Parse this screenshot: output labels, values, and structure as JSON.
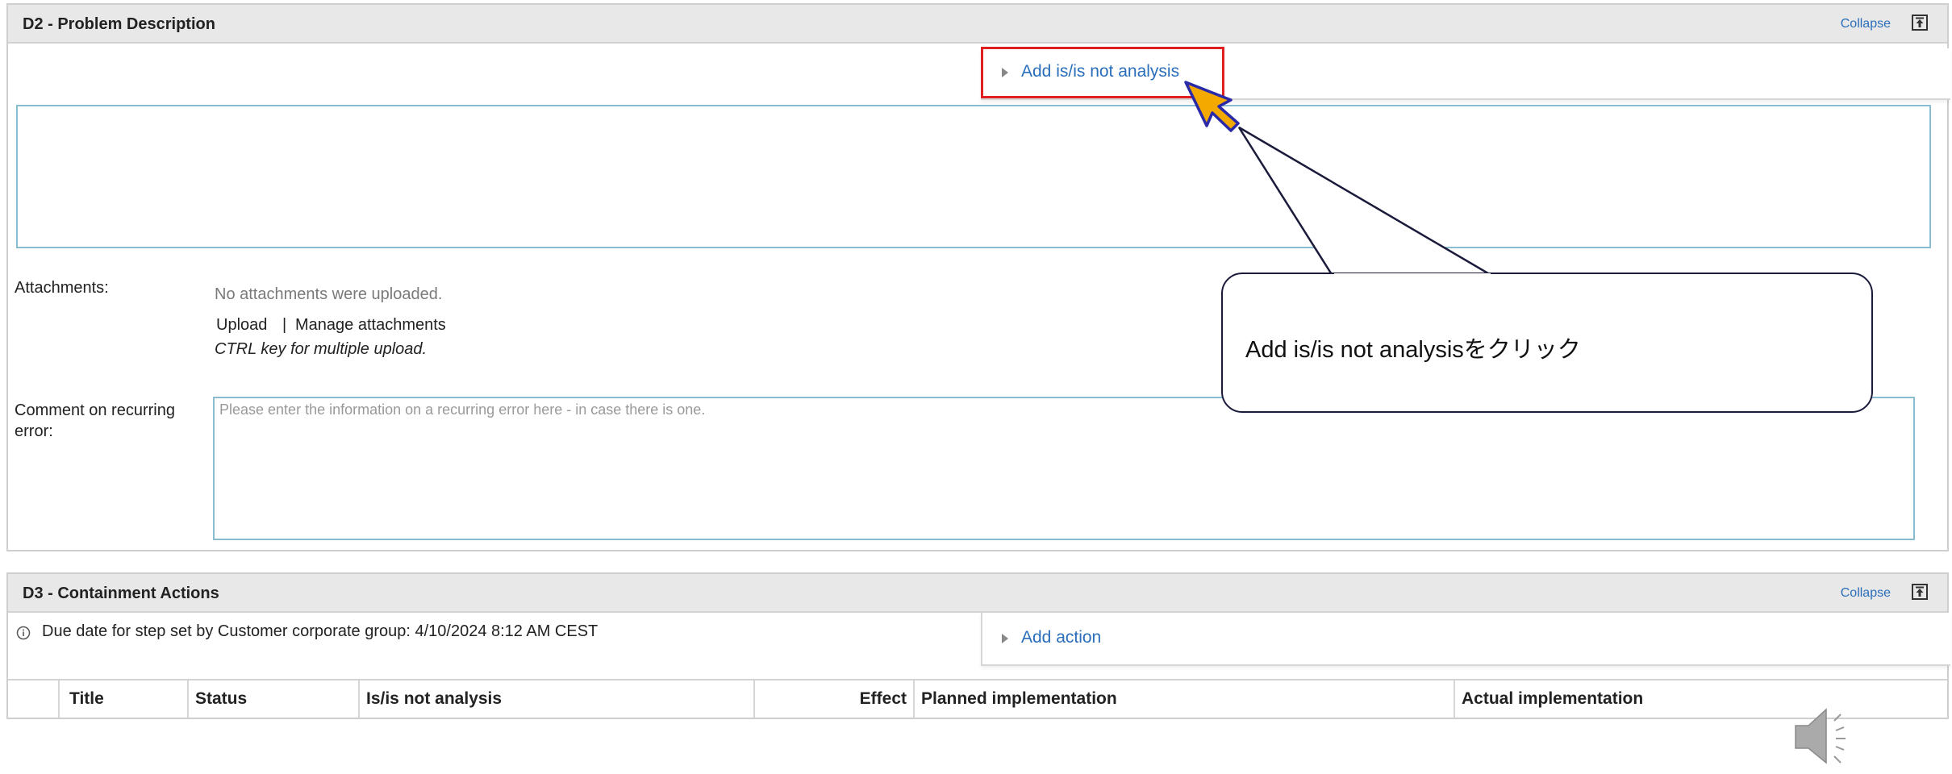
{
  "d2": {
    "title": "D2 - Problem Description",
    "collapse_label": "Collapse",
    "add_analysis_label": "Add is/is not analysis",
    "attachments_label": "Attachments:",
    "no_attachments_text": "No attachments were uploaded.",
    "upload_label": "Upload",
    "separator": "|",
    "manage_attachments_label": "Manage attachments",
    "multi_upload_hint": "CTRL key for multiple upload.",
    "comment_label": "Comment on recurring error:",
    "comment_placeholder": "Please enter the information on a recurring error here - in case there is one."
  },
  "d3": {
    "title": "D3 - Containment Actions",
    "collapse_label": "Collapse",
    "due_date_text": "Due date for step set by Customer corporate group: 4/10/2024 8:12 AM CEST",
    "add_action_label": "Add action",
    "columns": [
      "Title",
      "Status",
      "Is/is not analysis",
      "Effect",
      "Planned implementation",
      "Actual implementation"
    ]
  },
  "callout": {
    "text": "Add is/is not analysisをクリック"
  },
  "colors": {
    "link": "#2a6ebb",
    "highlight": "#e02020",
    "cursor": "#f4a900"
  },
  "icons": [
    "collapse-icon",
    "expand-triangle-icon",
    "info-icon",
    "cursor-arrow-icon",
    "speaker-icon"
  ]
}
